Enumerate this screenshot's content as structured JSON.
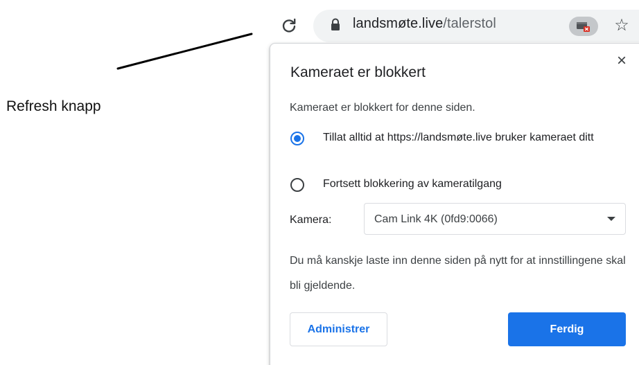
{
  "annotation": {
    "label": "Refresh knapp"
  },
  "toolbar": {
    "url_host": "landsmøte.live",
    "url_path": "/talerstol"
  },
  "popup": {
    "title": "Kameraet er blokkert",
    "description": "Kameraet er blokkert for denne siden.",
    "options": [
      {
        "label": "Tillat alltid at https://landsmøte.live bruker kameraet ditt",
        "selected": true
      },
      {
        "label": "Fortsett blokkering av kameratilgang",
        "selected": false
      }
    ],
    "camera_label": "Kamera:",
    "camera_selected": "Cam Link 4K (0fd9:0066)",
    "note": "Du må kanskje laste inn denne siden på nytt for at innstillingene skal bli gjeldende.",
    "manage_button": "Administrer",
    "done_button": "Ferdig"
  },
  "colors": {
    "accent": "#1a73e8",
    "blocked_badge": "#d93025"
  }
}
